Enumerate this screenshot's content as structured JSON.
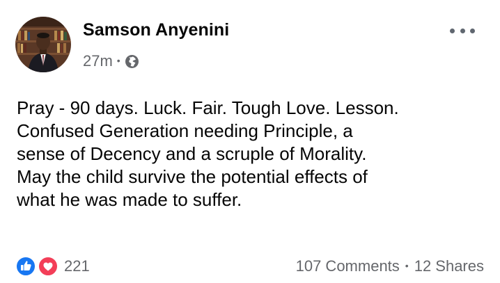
{
  "post": {
    "author": {
      "name": "Samson Anyenini",
      "avatar_icon": "profile-photo"
    },
    "timestamp": "27m",
    "meta_separator": "•",
    "privacy_icon": "globe-icon",
    "more_icon": "more-options-icon",
    "text_lines": [
      "Pray - 90 days. Luck. Fair. Tough Love. Lesson.",
      "Confused Generation needing Principle, a",
      "sense of Decency and a scruple of Morality.",
      "May the child survive the potential effects of",
      "what he was made to suffer."
    ],
    "reactions": {
      "icons": [
        "like-icon",
        "love-icon"
      ],
      "count": "221"
    },
    "engagement": {
      "comments": "107 Comments",
      "separator": "•",
      "shares": "12 Shares"
    },
    "colors": {
      "like_blue": "#1877f2",
      "love_red": "#f33e58",
      "secondary_text": "#65676b"
    }
  }
}
